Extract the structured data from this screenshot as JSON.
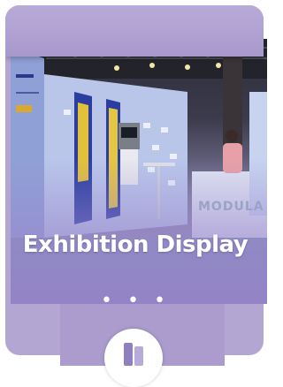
{
  "card": {
    "title": "Exhibition Display",
    "more_label": "• • •",
    "booth_sign": "MODULA",
    "icon": "panel-display-icon"
  },
  "colors": {
    "card_background": "#b4a6d2",
    "accent_purple": "#ab9ccd",
    "title_text": "#ffffff"
  }
}
